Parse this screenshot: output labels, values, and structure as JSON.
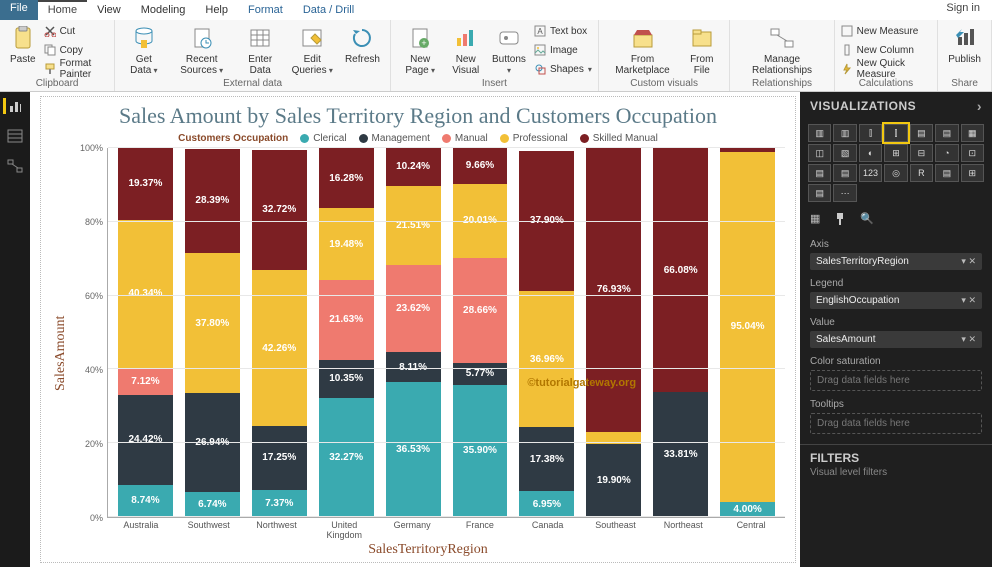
{
  "menu": {
    "file": "File",
    "home": "Home",
    "view": "View",
    "modeling": "Modeling",
    "help": "Help",
    "format": "Format",
    "datadrill": "Data / Drill",
    "signin": "Sign in"
  },
  "ribbon": {
    "paste": "Paste",
    "cut": "Cut",
    "copy": "Copy",
    "format_painter": "Format Painter",
    "clipboard": "Clipboard",
    "get_data": "Get\nData",
    "recent_sources": "Recent\nSources",
    "enter_data": "Enter\nData",
    "edit_queries": "Edit\nQueries",
    "refresh": "Refresh",
    "external_data": "External data",
    "new_page": "New\nPage",
    "new_visual": "New\nVisual",
    "buttons": "Buttons",
    "text_box": "Text box",
    "image": "Image",
    "shapes": "Shapes",
    "insert": "Insert",
    "from_marketplace": "From\nMarketplace",
    "from_file": "From\nFile",
    "custom_visuals": "Custom visuals",
    "manage_relationships": "Manage\nRelationships",
    "relationships": "Relationships",
    "new_measure": "New Measure",
    "new_column": "New Column",
    "new_quick_measure": "New Quick Measure",
    "calculations": "Calculations",
    "publish": "Publish",
    "share": "Share"
  },
  "chart_data": {
    "type": "bar",
    "stacked": true,
    "percent": true,
    "title": "Sales Amount by Sales Territory Region and Customers Occupation",
    "legend_title": "Customers Occupation",
    "xlabel": "SalesTerritoryRegion",
    "ylabel": "SalesAmount",
    "ylim": [
      0,
      100
    ],
    "yticks": [
      0,
      20,
      40,
      60,
      80,
      100
    ],
    "categories": [
      "Australia",
      "Southwest",
      "Northwest",
      "United Kingdom",
      "Germany",
      "France",
      "Canada",
      "Southeast",
      "Northeast",
      "Central"
    ],
    "series": [
      {
        "name": "Clerical",
        "color": "#3aaab0",
        "values": [
          8.74,
          6.74,
          7.37,
          32.27,
          36.53,
          35.9,
          6.95,
          0,
          0,
          4.0
        ]
      },
      {
        "name": "Management",
        "color": "#2f3a44",
        "values": [
          24.42,
          26.94,
          17.25,
          10.35,
          8.11,
          5.77,
          17.38,
          19.9,
          33.81,
          0
        ]
      },
      {
        "name": "Manual",
        "color": "#ef7a6f",
        "values": [
          7.12,
          0,
          0,
          21.63,
          23.62,
          28.66,
          0,
          0,
          0,
          0
        ]
      },
      {
        "name": "Professional",
        "color": "#f2c037",
        "values": [
          40.34,
          37.8,
          42.26,
          19.48,
          21.51,
          20.01,
          36.96,
          3.17,
          0,
          95.04
        ]
      },
      {
        "name": "Skilled Manual",
        "color": "#7c1f23",
        "values": [
          19.37,
          28.39,
          32.72,
          16.28,
          10.24,
          9.66,
          37.9,
          76.93,
          66.08,
          0.96
        ]
      }
    ]
  },
  "watermark": "©tutorialgateway.org",
  "rightpanel": {
    "title": "VISUALIZATIONS",
    "axis_label": "Axis",
    "axis_value": "SalesTerritoryRegion",
    "legend_label": "Legend",
    "legend_value": "EnglishOccupation",
    "value_label": "Value",
    "value_value": "SalesAmount",
    "color_sat": "Color saturation",
    "drag_hint": "Drag data fields here",
    "tooltips": "Tooltips",
    "filters": "FILTERS",
    "filters_sub": "Visual level filters",
    "pill_x": "✕",
    "chev": "›"
  },
  "viz_icons": [
    "▥",
    "▥",
    "⫿",
    "⫿",
    "▤",
    "▤",
    "▦",
    "◫",
    "▧",
    "◐",
    "⊞",
    "⊟",
    "◔",
    "⊡",
    "▤",
    "▤",
    "123",
    "◎",
    "R",
    "▤",
    "⊞",
    "▤",
    "⋯"
  ]
}
